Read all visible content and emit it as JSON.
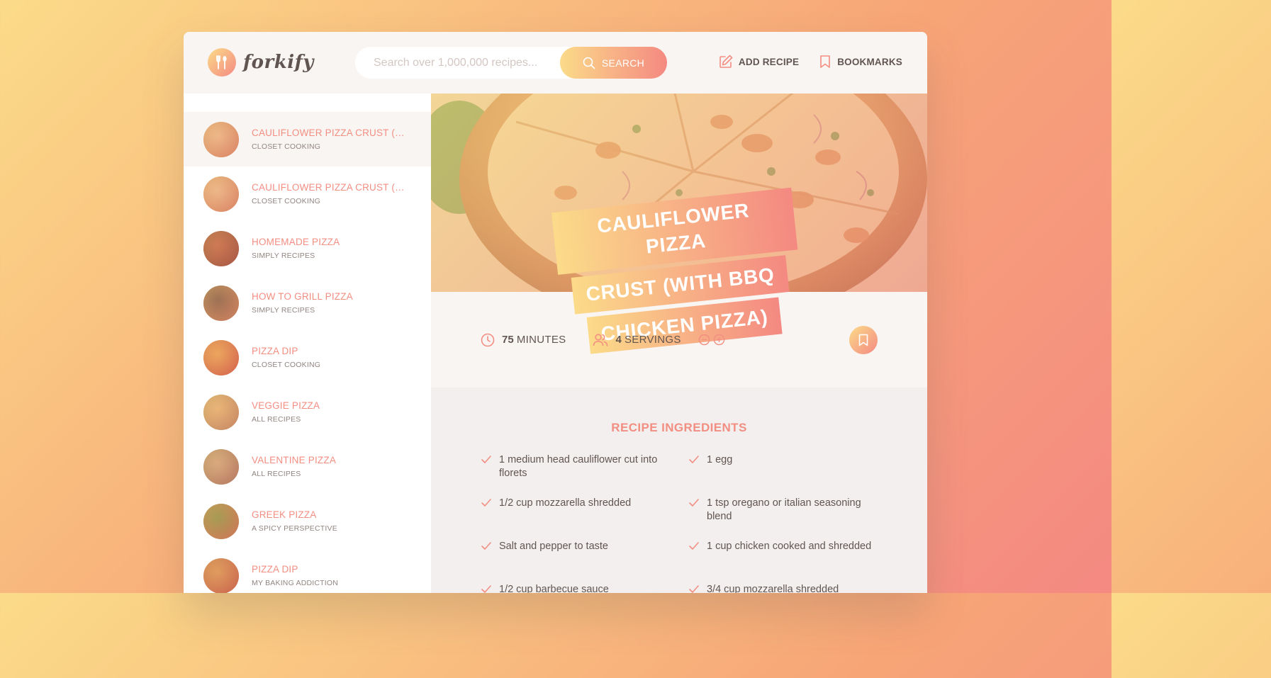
{
  "app": {
    "logo_text": "forkify",
    "accent_color": "#f38e82"
  },
  "search": {
    "placeholder": "Search over 1,000,000 recipes...",
    "button_label": "SEARCH"
  },
  "nav": {
    "add_recipe_label": "ADD RECIPE",
    "bookmarks_label": "BOOKMARKS"
  },
  "results": [
    {
      "title": "CAULIFLOWER PIZZA CRUST (WIT...",
      "publisher": "CLOSET COOKING",
      "active": true
    },
    {
      "title": "CAULIFLOWER PIZZA CRUST (WIT...",
      "publisher": "CLOSET COOKING"
    },
    {
      "title": "HOMEMADE PIZZA",
      "publisher": "SIMPLY RECIPES"
    },
    {
      "title": "HOW TO GRILL PIZZA",
      "publisher": "SIMPLY RECIPES"
    },
    {
      "title": "PIZZA DIP",
      "publisher": "CLOSET COOKING"
    },
    {
      "title": "VEGGIE PIZZA",
      "publisher": "ALL RECIPES"
    },
    {
      "title": "VALENTINE PIZZA",
      "publisher": "ALL RECIPES"
    },
    {
      "title": "GREEK PIZZA",
      "publisher": "A SPICY PERSPECTIVE"
    },
    {
      "title": "PIZZA DIP",
      "publisher": "MY BAKING ADDICTION"
    }
  ],
  "recipe": {
    "title_lines": [
      "CAULIFLOWER PIZZA",
      "CRUST (WITH BBQ",
      "CHICKEN PIZZA)"
    ],
    "cooking_time": "75",
    "time_unit": "MINUTES",
    "servings": "4",
    "servings_unit": "SERVINGS",
    "ingredients_heading": "RECIPE INGREDIENTS",
    "ingredients": [
      "1 medium head cauliflower cut into florets",
      "1 egg",
      "1/2 cup mozzarella shredded",
      "1 tsp oregano or italian seasoning blend",
      "Salt and pepper to taste",
      "1 cup chicken cooked and shredded",
      "1/2 cup barbecue sauce",
      "3/4 cup mozzarella shredded"
    ]
  }
}
